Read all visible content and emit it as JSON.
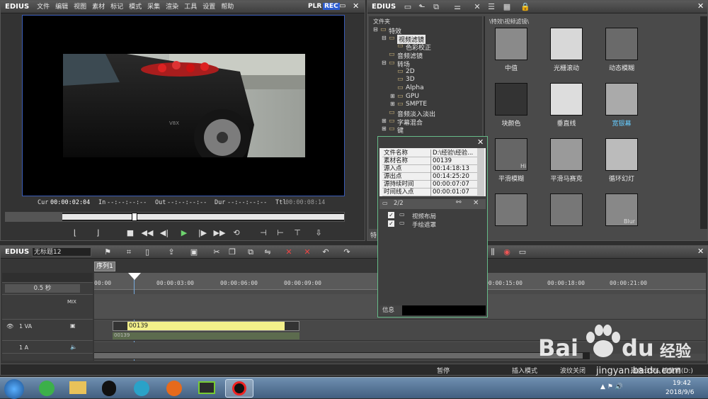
{
  "app": {
    "brand": "EDIUS",
    "menu": [
      "文件",
      "编辑",
      "视图",
      "素材",
      "标记",
      "模式",
      "采集",
      "渲染",
      "工具",
      "设置",
      "帮助"
    ],
    "plr": "PLR",
    "rec": "REC"
  },
  "preview": {
    "cur_label": "Cur",
    "cur_value": "00:00:02:04",
    "in_label": "In",
    "in_value": "--:--:--:--",
    "out_label": "Out",
    "out_value": "--:--:--:--",
    "dur_label": "Dur",
    "dur_value": "--:--:--:--",
    "ttl_label": "Ttl",
    "ttl_value": "00:00:08:14",
    "image_plate": "V8X"
  },
  "effects_panel": {
    "brand": "EDIUS",
    "folder_header": "文件夹",
    "path": "\\特效\\视频滤镜\\",
    "tree": [
      {
        "label": "特效",
        "level": 0,
        "expander": "-"
      },
      {
        "label": "视频滤镜",
        "level": 1,
        "expander": "-",
        "selected": true
      },
      {
        "label": "色彩校正",
        "level": 2,
        "expander": ""
      },
      {
        "label": "音频滤镜",
        "level": 1,
        "expander": ""
      },
      {
        "label": "转场",
        "level": 1,
        "expander": "-"
      },
      {
        "label": "2D",
        "level": 2,
        "expander": ""
      },
      {
        "label": "3D",
        "level": 2,
        "expander": ""
      },
      {
        "label": "Alpha",
        "level": 2,
        "expander": ""
      },
      {
        "label": "GPU",
        "level": 2,
        "expander": "+"
      },
      {
        "label": "SMPTE",
        "level": 2,
        "expander": "+"
      },
      {
        "label": "音频淡入淡出",
        "level": 1,
        "expander": ""
      },
      {
        "label": "字幕混合",
        "level": 1,
        "expander": "+"
      },
      {
        "label": "键",
        "level": 1,
        "expander": "+"
      }
    ],
    "effects": [
      {
        "label": "中值"
      },
      {
        "label": "光栅滚动"
      },
      {
        "label": "动态模糊"
      },
      {
        "label": "块颜色"
      },
      {
        "label": "垂直线"
      },
      {
        "label": "宽银幕"
      },
      {
        "label": "平滑模糊"
      },
      {
        "label": "平滑马赛克"
      },
      {
        "label": "循环幻灯"
      },
      {
        "label": ""
      },
      {
        "label": ""
      },
      {
        "label": ""
      }
    ],
    "thumb_hi": "Hi",
    "thumb_blur": "Blur",
    "bottom_tab": "特"
  },
  "info_panel": {
    "rows": [
      {
        "k": "文件名称",
        "v": "D:\\经验\\经验..."
      },
      {
        "k": "素材名称",
        "v": "00139"
      },
      {
        "k": "源入点",
        "v": "00:14:18:13"
      },
      {
        "k": "源出点",
        "v": "00:14:25:20"
      },
      {
        "k": "源持续时间",
        "v": "00:00:07:07"
      },
      {
        "k": "时间线入点",
        "v": "00:00:01:07"
      }
    ],
    "layer_count": "2/2",
    "layers": [
      {
        "label": "视频布局"
      },
      {
        "label": "手绘遮罩"
      }
    ],
    "bottom_label": "信息"
  },
  "timeline": {
    "brand": "EDIUS",
    "project": "无标题12",
    "sequence_tab": "序列1",
    "zoom": "0.5 秒",
    "ruler": [
      "00:00",
      "00:00:03:00",
      "00:00:06:00",
      "00:00:09:00",
      "00:00:15:00",
      "00:00:18:00",
      "00:00:21:00"
    ],
    "track_va": "1 VA",
    "track_a": "1 A",
    "mix_label": "MIX",
    "clip_name": "00139",
    "clip_sub": "00139"
  },
  "statusbar": {
    "pause": "暂停",
    "insert": "插入模式",
    "ripple": "波纹关闭",
    "disk": "磁盘:35% 被使用(D:)"
  },
  "taskbar": {
    "time": "19:42",
    "date": "2018/9/6"
  },
  "watermark": {
    "brand": "Bai",
    "brand2": "du",
    "suffix": "经验",
    "url": "jingyan.baidu.com"
  }
}
